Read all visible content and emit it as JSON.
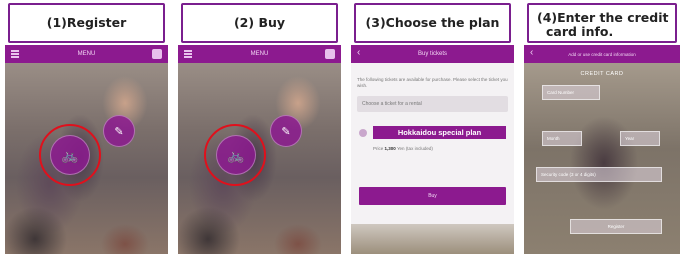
{
  "steps": [
    {
      "label": "(1)Register",
      "appbar_title": "MENU"
    },
    {
      "label": "(2) Buy",
      "appbar_title": "MENU"
    },
    {
      "label": "(3)Choose the plan",
      "appbar_title": "Buy tickets",
      "intro_text": "The following tickets are available for purchase. Please select the ticket you wish.",
      "select_placeholder": "Choose a ticket for a rental",
      "plan_name": "Hokkaidou special plan",
      "price_label": "Price",
      "price_value": "1,300",
      "price_note": "Yen (tax included)",
      "buy_button": "Buy"
    },
    {
      "label": "(4)Enter the credit card info.",
      "label_line1": "(4)Enter the credit",
      "label_line2": "card info.",
      "appbar_title": "Add or use credit card information",
      "card_title": "CREDIT CARD",
      "card_number_placeholder": "Card Number",
      "month_placeholder": "Month",
      "year_placeholder": "Year",
      "security_code_placeholder": "Security code (3 or 4 digits)",
      "register_button": "Register"
    }
  ],
  "colors": {
    "brand_purple": "#8c1a8f",
    "highlight_ring": "#e0101c",
    "label_border": "#7a1f8e"
  },
  "icons": [
    "menu-icon",
    "back-icon",
    "bicycle-icon",
    "tag-icon"
  ]
}
